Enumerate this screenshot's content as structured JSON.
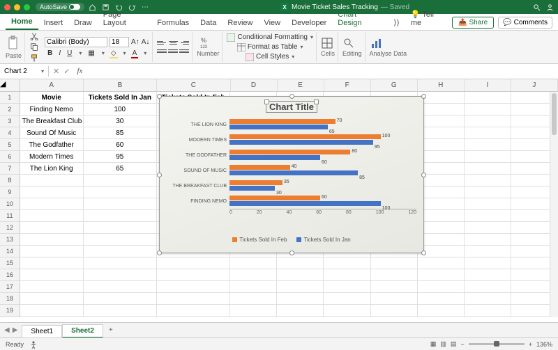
{
  "titlebar": {
    "autosave_label": "AutoSave",
    "autosave_state": "ON",
    "doc_title": "Movie Ticket Sales Tracking",
    "saved_label": "— Saved"
  },
  "tabs": {
    "items": [
      "Home",
      "Insert",
      "Draw",
      "Page Layout",
      "Formulas",
      "Data",
      "Review",
      "View",
      "Developer",
      "Chart Design"
    ],
    "active": "Home",
    "tellme": "Tell me",
    "share": "Share",
    "comments": "Comments"
  },
  "ribbon": {
    "paste": "Paste",
    "font_name": "Calibri (Body)",
    "font_size": "18",
    "number_label": "Number",
    "cond_fmt": "Conditional Formatting",
    "fmt_table": "Format as Table",
    "cell_styles": "Cell Styles",
    "cells": "Cells",
    "editing": "Editing",
    "analyse": "Analyse Data"
  },
  "namebox": {
    "value": "Chart 2"
  },
  "columns": [
    "A",
    "B",
    "C",
    "D",
    "E",
    "F",
    "G",
    "H",
    "I",
    "J"
  ],
  "headers": {
    "a": "Movie",
    "b": "Tickets Sold In Jan",
    "c": "Tickets Sold In Feb"
  },
  "data_rows": [
    {
      "movie": "Finding Nemo",
      "jan": "100",
      "feb": "60"
    },
    {
      "movie": "The Breakfast Club",
      "jan": "30",
      "feb": ""
    },
    {
      "movie": "Sound Of Music",
      "jan": "85",
      "feb": ""
    },
    {
      "movie": "The Godfather",
      "jan": "60",
      "feb": ""
    },
    {
      "movie": "Modern Times",
      "jan": "95",
      "feb": ""
    },
    {
      "movie": "The Lion King",
      "jan": "65",
      "feb": ""
    }
  ],
  "chart_data": {
    "type": "bar",
    "title": "Chart Title",
    "categories": [
      "THE LION KING",
      "MODERN TIMES",
      "THE GODFATHER",
      "SOUND OF MUSIC",
      "THE BREAKFAST CLUB",
      "FINDING NEMO"
    ],
    "series": [
      {
        "name": "Tickets Sold In Feb",
        "color": "#ed7d31",
        "values": [
          70,
          100,
          80,
          40,
          35,
          60
        ]
      },
      {
        "name": "Tickets Sold In Jan",
        "color": "#4472c4",
        "values": [
          65,
          95,
          60,
          85,
          30,
          100
        ]
      }
    ],
    "xticks": [
      "0",
      "20",
      "40",
      "60",
      "80",
      "100",
      "120"
    ],
    "xlim": [
      0,
      120
    ]
  },
  "sheets": {
    "items": [
      "Sheet1",
      "Sheet2"
    ],
    "active": "Sheet2"
  },
  "status": {
    "ready": "Ready",
    "zoom": "136%"
  }
}
